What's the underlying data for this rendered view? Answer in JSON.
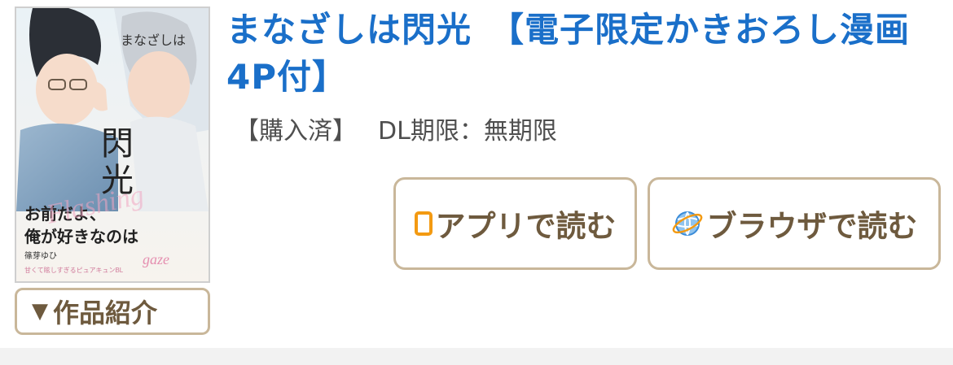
{
  "book": {
    "title": "まなざしは閃光　【電子限定かきおろし漫画4P付】",
    "purchase_status": "【購入済】",
    "dl_limit": "DL期限：無期限",
    "cover": {
      "title_text": "まなざしは閃光",
      "tagline": "お前だよ、俺が好きなのは",
      "author": "篠芽ゆひ",
      "english_text": "Flashing gaze",
      "icon": "book-cover-illustration"
    }
  },
  "actions": {
    "read_in_app": "アプリで読む",
    "read_in_browser": "ブラウザで読む",
    "app_icon": "smartphone-icon",
    "browser_icon": "globe-icon"
  },
  "intro": {
    "toggle_symbol": "▼",
    "label": "作品紹介"
  },
  "colors": {
    "title": "#1a6fc9",
    "button_border": "#c9b79a",
    "button_text": "#6e5a3e",
    "app_icon": "#f39a12",
    "globe_icon": "#3a8bd8"
  }
}
